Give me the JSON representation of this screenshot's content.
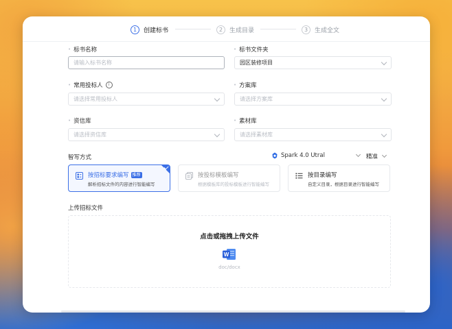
{
  "steps": [
    {
      "num": "1",
      "label": "创建标书"
    },
    {
      "num": "2",
      "label": "生成目录"
    },
    {
      "num": "3",
      "label": "生成全文"
    }
  ],
  "fields": {
    "bid_name": {
      "label": "标书名称",
      "placeholder": "请输入标书名称"
    },
    "bid_folder": {
      "label": "标书文件夹",
      "value": "园区装修项目"
    },
    "bidder": {
      "label": "常用投标人",
      "placeholder": "请选择常用投标人"
    },
    "scheme_lib": {
      "label": "方案库",
      "placeholder": "请选择方案库"
    },
    "credential_lib": {
      "label": "资信库",
      "placeholder": "请选择资信库"
    },
    "material_lib": {
      "label": "素材库",
      "placeholder": "请选择素材库"
    }
  },
  "writing": {
    "label": "智写方式",
    "model": "Spark 4.0 Utral",
    "precision": "精准",
    "modes": [
      {
        "title": "按招标要求编写",
        "badge": "推荐",
        "desc": "解析招标文件的内容进行智能编写",
        "selected": true,
        "icon": "document-list-icon"
      },
      {
        "title": "按投标模板编写",
        "desc": "根据模板库的投标模板进行智能编写",
        "selected": false,
        "icon": "template-copy-icon"
      },
      {
        "title": "按目录编写",
        "desc": "自定义目录，根据目录进行智能编写",
        "selected": false,
        "icon": "outline-list-icon"
      }
    ]
  },
  "upload": {
    "label": "上传招标文件",
    "title": "点击或拖拽上传文件",
    "hint": "doc/docx"
  },
  "colors": {
    "accent": "#3b6fe6",
    "word_blue": "#2b5fd9"
  }
}
